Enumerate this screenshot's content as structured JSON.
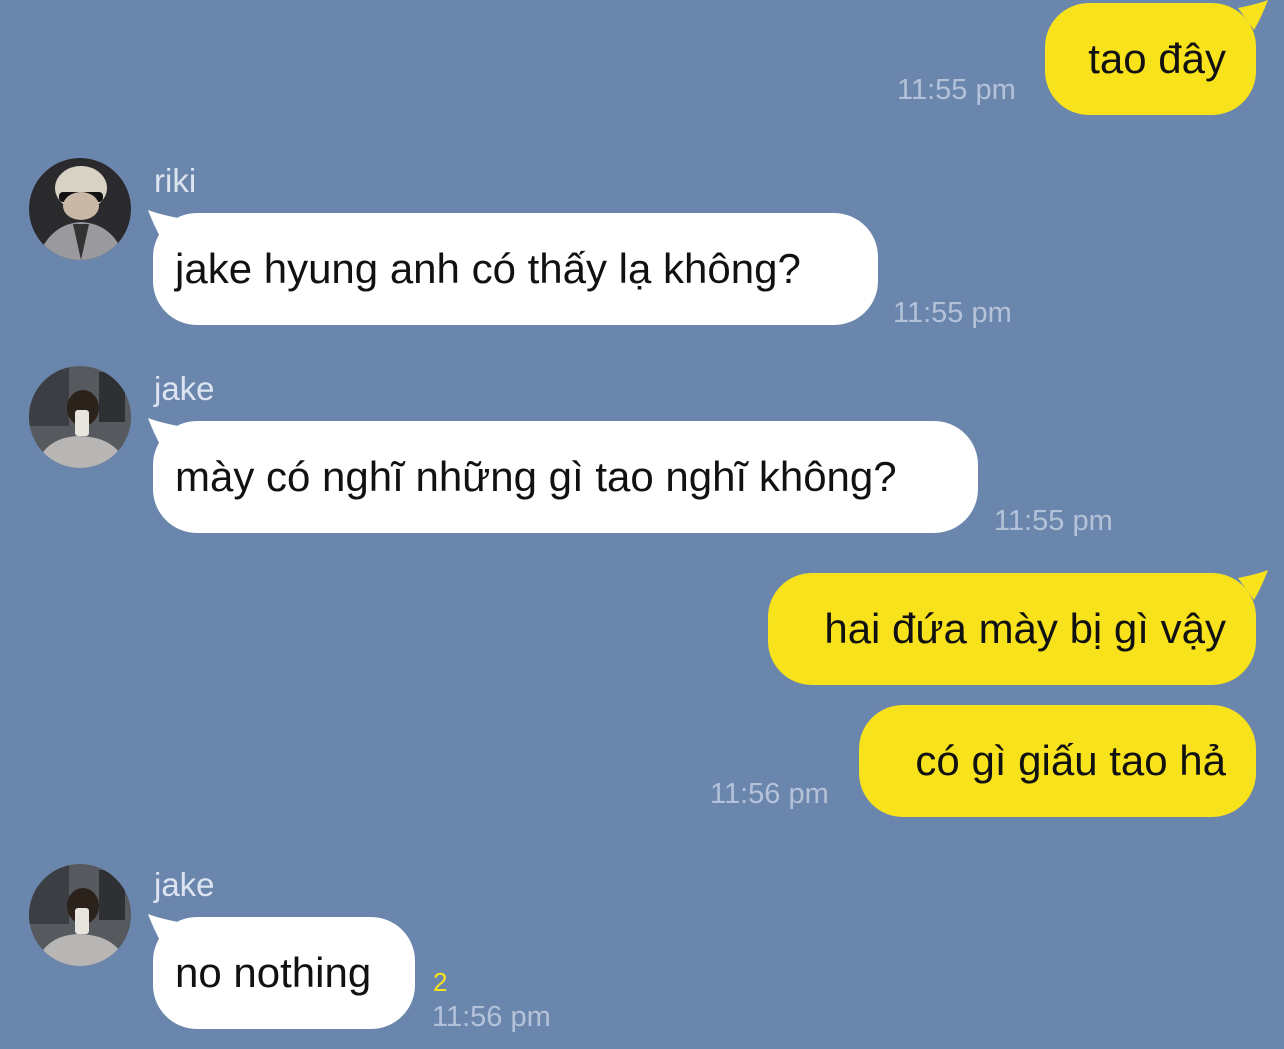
{
  "colors": {
    "background": "#6b86ad",
    "outgoing_bubble": "#f8e21b",
    "incoming_bubble": "#ffffff",
    "timestamp": "#b4c2d9",
    "sender_name": "#dce4f0",
    "read_count": "#f8e21b"
  },
  "messages": [
    {
      "direction": "out",
      "text": "tao đây",
      "time": "11:55 pm"
    },
    {
      "direction": "in",
      "sender": "riki",
      "avatar": "riki-avatar",
      "text": "jake hyung anh có thấy lạ không?",
      "time": "11:55 pm"
    },
    {
      "direction": "in",
      "sender": "jake",
      "avatar": "jake-avatar",
      "text": "mày có nghĩ những gì tao nghĩ không?",
      "time": "11:55 pm"
    },
    {
      "direction": "out",
      "text": "hai đứa mày bị gì vậy"
    },
    {
      "direction": "out",
      "text": "có gì giấu tao hả",
      "time": "11:56 pm"
    },
    {
      "direction": "in",
      "sender": "jake",
      "avatar": "jake-avatar",
      "text": "no nothing",
      "read_count": "2",
      "time": "11:56 pm"
    }
  ]
}
